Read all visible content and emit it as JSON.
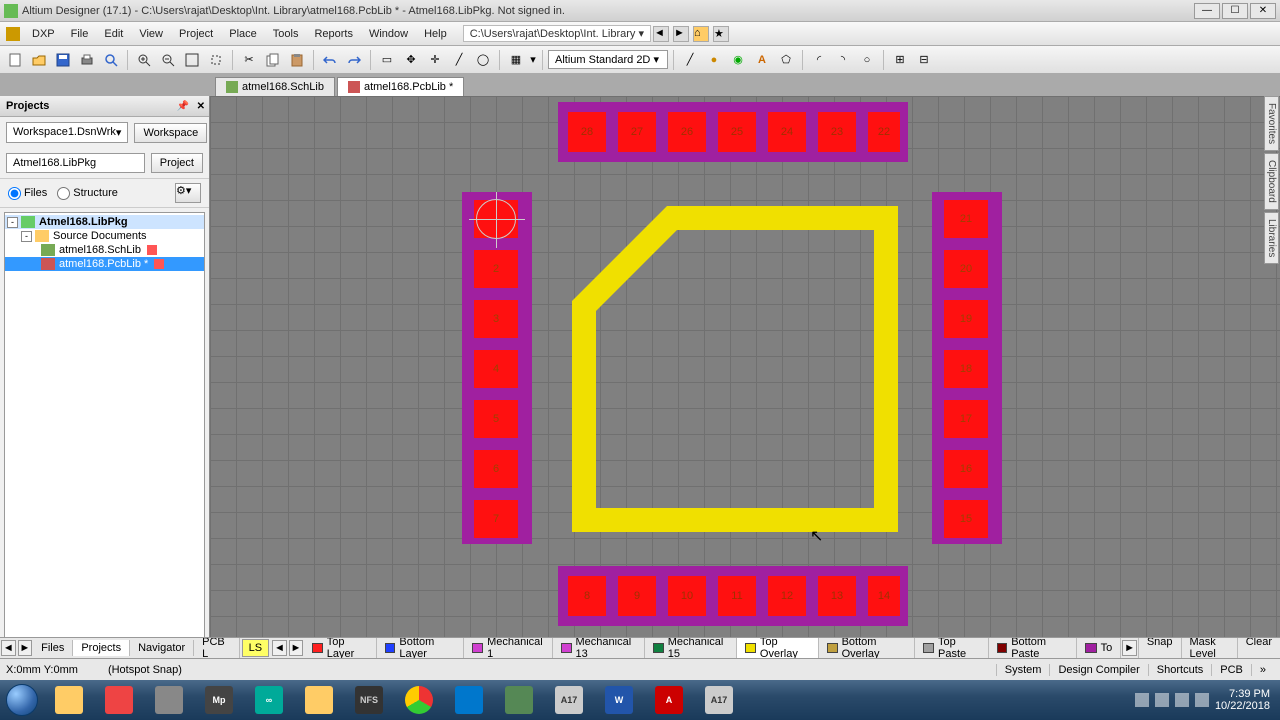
{
  "title": "Altium Designer (17.1) - C:\\Users\\rajat\\Desktop\\Int. Library\\atmel168.PcbLib * - Atmel168.LibPkg. Not signed in.",
  "menu": {
    "items": [
      "DXP",
      "File",
      "Edit",
      "View",
      "Project",
      "Place",
      "Tools",
      "Reports",
      "Window",
      "Help"
    ],
    "path": "C:\\Users\\rajat\\Desktop\\Int. Library ▾"
  },
  "toolbar": {
    "viewmode": "Altium Standard 2D"
  },
  "doctabs": {
    "t1": "atmel168.SchLib",
    "t2": "atmel168.PcbLib *"
  },
  "projects": {
    "title": "Projects",
    "workspace": "Workspace1.DsnWrk",
    "workspace_btn": "Workspace",
    "project": "Atmel168.LibPkg",
    "project_btn": "Project",
    "radio_files": "Files",
    "radio_structure": "Structure",
    "tree": {
      "root": "Atmel168.LibPkg",
      "folder": "Source Documents",
      "file1": "atmel168.SchLib",
      "file2": "atmel168.PcbLib *"
    }
  },
  "pads": {
    "left": [
      "1",
      "2",
      "3",
      "4",
      "5",
      "6",
      "7"
    ],
    "right": [
      "21",
      "20",
      "19",
      "18",
      "17",
      "16",
      "15"
    ],
    "top": [
      "28",
      "27",
      "26",
      "25",
      "24",
      "23",
      "22"
    ],
    "bottom": [
      "8",
      "9",
      "10",
      "11",
      "12",
      "13",
      "14"
    ]
  },
  "bottomnav": {
    "tabs": [
      "Files",
      "Projects",
      "Navigator",
      "PCB L"
    ]
  },
  "layertabs": {
    "ls_label": "LS",
    "layers": [
      {
        "name": "Top Layer",
        "color": "#ff2020"
      },
      {
        "name": "Bottom Layer",
        "color": "#2040ff"
      },
      {
        "name": "Mechanical 1",
        "color": "#d040d0"
      },
      {
        "name": "Mechanical 13",
        "color": "#d040d0"
      },
      {
        "name": "Mechanical 15",
        "color": "#108040"
      },
      {
        "name": "Top Overlay",
        "color": "#f0e000"
      },
      {
        "name": "Bottom Overlay",
        "color": "#c0a040"
      },
      {
        "name": "Top Paste",
        "color": "#a0a0a0"
      },
      {
        "name": "Bottom Paste",
        "color": "#800000"
      },
      {
        "name": "To",
        "color": "#a020a0"
      }
    ],
    "right": [
      "Snap",
      "Mask Level",
      "Clear"
    ]
  },
  "status": {
    "coords": "X:0mm Y:0mm",
    "snap": "(Hotspot Snap)",
    "right": [
      "System",
      "Design Compiler",
      "Shortcuts",
      "PCB"
    ]
  },
  "sidetabs": [
    "Favorites",
    "Clipboard",
    "Libraries"
  ],
  "tray": {
    "time": "7:39 PM",
    "date": "10/22/2018"
  },
  "colors": {
    "padbg": "#a020a0",
    "pad": "#ff1010",
    "overlay": "#f0e000"
  }
}
